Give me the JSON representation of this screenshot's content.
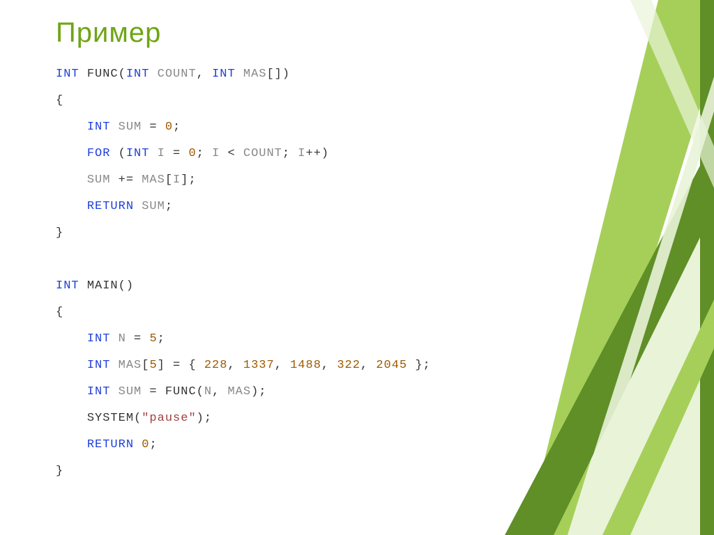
{
  "title": {
    "text": "Пример",
    "color": "#6fa516"
  },
  "code": {
    "tokens": [
      [
        [
          "kw",
          "int"
        ],
        [
          "pn",
          " "
        ],
        [
          "fn",
          "func"
        ],
        [
          "pn",
          "("
        ],
        [
          "kw",
          "int"
        ],
        [
          "pn",
          " "
        ],
        [
          "id",
          "count"
        ],
        [
          "pn",
          ", "
        ],
        [
          "kw",
          "int"
        ],
        [
          "pn",
          " "
        ],
        [
          "id",
          "mas"
        ],
        [
          "pn",
          "[])"
        ]
      ],
      [
        [
          "pn",
          "{"
        ]
      ],
      [
        [
          "pn",
          "    "
        ],
        [
          "kw",
          "int"
        ],
        [
          "pn",
          " "
        ],
        [
          "id",
          "sum"
        ],
        [
          "pn",
          " = "
        ],
        [
          "nm",
          "0"
        ],
        [
          "pn",
          ";"
        ]
      ],
      [
        [
          "pn",
          "    "
        ],
        [
          "kw",
          "for"
        ],
        [
          "pn",
          " ("
        ],
        [
          "kw",
          "int"
        ],
        [
          "pn",
          " "
        ],
        [
          "id",
          "i"
        ],
        [
          "pn",
          " = "
        ],
        [
          "nm",
          "0"
        ],
        [
          "pn",
          "; "
        ],
        [
          "id",
          "i"
        ],
        [
          "pn",
          " < "
        ],
        [
          "id",
          "count"
        ],
        [
          "pn",
          "; "
        ],
        [
          "id",
          "i"
        ],
        [
          "pn",
          "++)"
        ]
      ],
      [
        [
          "pn",
          "    "
        ],
        [
          "id",
          "sum"
        ],
        [
          "pn",
          " += "
        ],
        [
          "id",
          "mas"
        ],
        [
          "pn",
          "["
        ],
        [
          "id",
          "i"
        ],
        [
          "pn",
          "];"
        ]
      ],
      [
        [
          "pn",
          "    "
        ],
        [
          "kw",
          "return"
        ],
        [
          "pn",
          " "
        ],
        [
          "id",
          "sum"
        ],
        [
          "pn",
          ";"
        ]
      ],
      [
        [
          "pn",
          "}"
        ]
      ],
      [
        [
          "pn",
          ""
        ]
      ],
      [
        [
          "kw",
          "int"
        ],
        [
          "pn",
          " "
        ],
        [
          "fn",
          "main"
        ],
        [
          "pn",
          "()"
        ]
      ],
      [
        [
          "pn",
          "{"
        ]
      ],
      [
        [
          "pn",
          "    "
        ],
        [
          "kw",
          "int"
        ],
        [
          "pn",
          " "
        ],
        [
          "id",
          "n"
        ],
        [
          "pn",
          " = "
        ],
        [
          "nm",
          "5"
        ],
        [
          "pn",
          ";"
        ]
      ],
      [
        [
          "pn",
          "    "
        ],
        [
          "kw",
          "int"
        ],
        [
          "pn",
          " "
        ],
        [
          "id",
          "mas"
        ],
        [
          "pn",
          "["
        ],
        [
          "nm",
          "5"
        ],
        [
          "pn",
          "] = { "
        ],
        [
          "nm",
          "228"
        ],
        [
          "pn",
          ", "
        ],
        [
          "nm",
          "1337"
        ],
        [
          "pn",
          ", "
        ],
        [
          "nm",
          "1488"
        ],
        [
          "pn",
          ", "
        ],
        [
          "nm",
          "322"
        ],
        [
          "pn",
          ", "
        ],
        [
          "nm",
          "2045"
        ],
        [
          "pn",
          " };"
        ]
      ],
      [
        [
          "pn",
          "    "
        ],
        [
          "kw",
          "int"
        ],
        [
          "pn",
          " "
        ],
        [
          "id",
          "sum"
        ],
        [
          "pn",
          " = "
        ],
        [
          "fn",
          "func"
        ],
        [
          "pn",
          "("
        ],
        [
          "id",
          "n"
        ],
        [
          "pn",
          ", "
        ],
        [
          "id",
          "mas"
        ],
        [
          "pn",
          ");"
        ]
      ],
      [
        [
          "pn",
          "    "
        ],
        [
          "fn",
          "system"
        ],
        [
          "pn",
          "("
        ],
        [
          "st",
          "\"pause\""
        ],
        [
          "pn",
          ");"
        ]
      ],
      [
        [
          "pn",
          "    "
        ],
        [
          "kw",
          "return"
        ],
        [
          "pn",
          " "
        ],
        [
          "nm",
          "0"
        ],
        [
          "pn",
          ";"
        ]
      ],
      [
        [
          "pn",
          "}"
        ]
      ]
    ]
  },
  "deco": {
    "colors": {
      "dark": "#5f8f26",
      "mid": "#a6cf5a",
      "light": "#e9f3d8",
      "pale": "#f4f9ec"
    }
  }
}
